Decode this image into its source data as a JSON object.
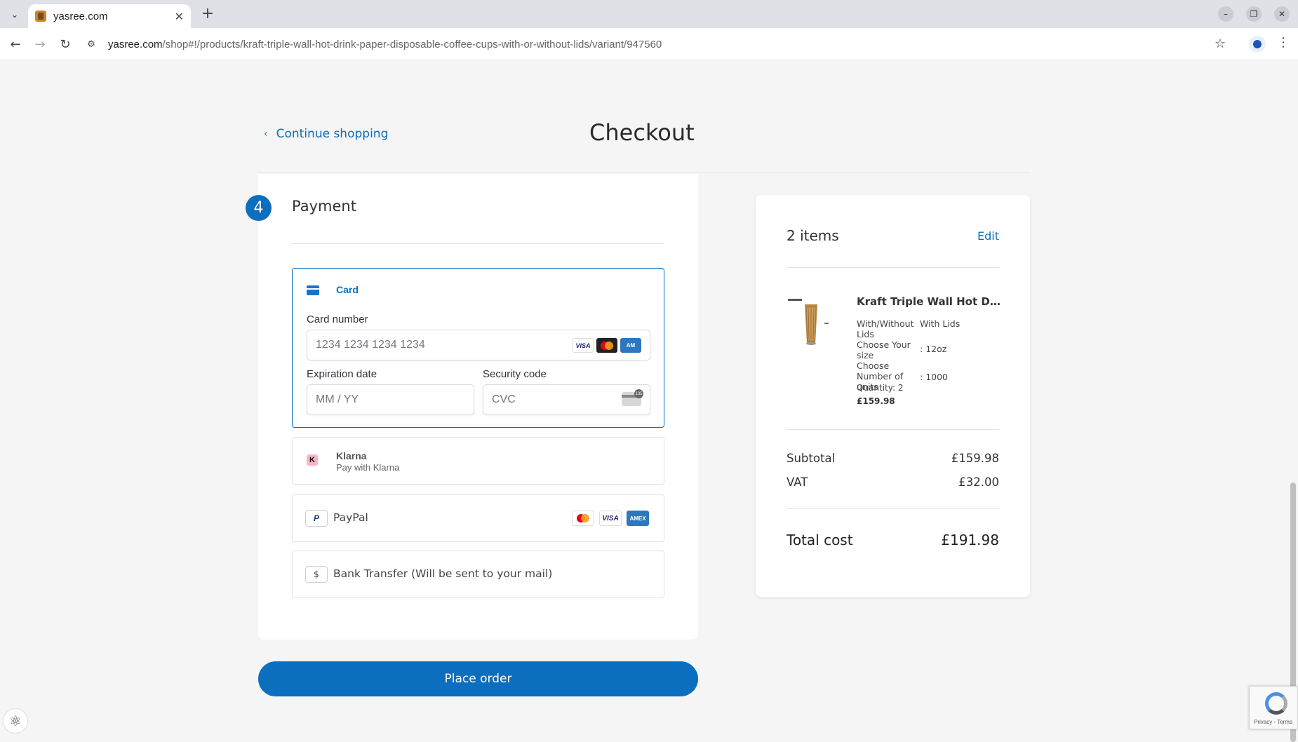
{
  "browser": {
    "tab_title": "yasree.com",
    "url_domain": "yasree.com",
    "url_path": "/shop#!/products/kraft-triple-wall-hot-drink-paper-disposable-coffee-cups-with-or-without-lids/variant/947560"
  },
  "header": {
    "continue_label": "Continue shopping",
    "title": "Checkout"
  },
  "payment": {
    "step_number": "4",
    "title": "Payment",
    "card": {
      "label": "Card",
      "card_number_label": "Card number",
      "card_number_placeholder": "1234 1234 1234 1234",
      "expiry_label": "Expiration date",
      "expiry_placeholder": "MM / YY",
      "cvc_label": "Security code",
      "cvc_placeholder": "CVC",
      "brands": [
        "VISA",
        "MC",
        "AMEX"
      ]
    },
    "klarna": {
      "badge": "K",
      "name": "Klarna",
      "subtitle": "Pay with Klarna"
    },
    "paypal": {
      "label": "PayPal",
      "brands": [
        "MC",
        "VISA",
        "AMEX"
      ]
    },
    "bank": {
      "icon_text": "$",
      "label": "Bank Transfer (Will be sent to your mail)"
    },
    "place_order_label": "Place order"
  },
  "summary": {
    "items_count": "2 items",
    "edit_label": "Edit",
    "product": {
      "name": "Kraft Triple Wall Hot Drin...",
      "attributes": [
        {
          "name": "With/Without Lids",
          "value": "With Lids"
        },
        {
          "name": "Choose Your size",
          "value": "12oz"
        },
        {
          "name": "Choose Number of units",
          "value": "1000"
        }
      ],
      "quantity": "Quantity: 2",
      "price": "£159.98"
    },
    "subtotal_label": "Subtotal",
    "subtotal_value": "£159.98",
    "vat_label": "VAT",
    "vat_value": "£32.00",
    "total_label": "Total cost",
    "total_value": "£191.98"
  },
  "recaptcha": {
    "text": "Privacy - Terms"
  },
  "colors": {
    "accent": "#0c6ebf",
    "background": "#f5f5f5"
  }
}
